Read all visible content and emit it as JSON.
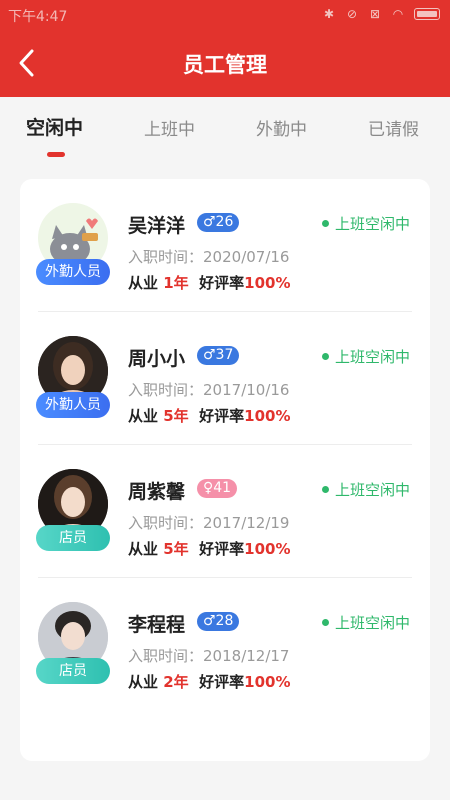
{
  "statusbar": {
    "time": "下午4:47"
  },
  "header": {
    "title": "员工管理"
  },
  "tabs": [
    "空闲中",
    "上班中",
    "外勤中",
    "已请假"
  ],
  "labels": {
    "hire_prefix": "入职时间：",
    "years_prefix": "从业",
    "rating_prefix": "好评率"
  },
  "employees": [
    {
      "name": "吴洋洋",
      "gender": "♂26",
      "gender_type": "male",
      "role": "外勤人员",
      "status": "上班空闲中",
      "hire_date": "2020/07/16",
      "years": "1年",
      "rating": "100%"
    },
    {
      "name": "周小小",
      "gender": "♂37",
      "gender_type": "male",
      "role": "外勤人员",
      "status": "上班空闲中",
      "hire_date": "2017/10/16",
      "years": "5年",
      "rating": "100%"
    },
    {
      "name": "周紫馨",
      "gender": "♀41",
      "gender_type": "female",
      "role": "店员",
      "status": "上班空闲中",
      "hire_date": "2017/12/19",
      "years": "5年",
      "rating": "100%"
    },
    {
      "name": "李程程",
      "gender": "♂28",
      "gender_type": "male",
      "role": "店员",
      "status": "上班空闲中",
      "hire_date": "2018/12/17",
      "years": "2年",
      "rating": "100%"
    }
  ],
  "colors": {
    "brand": "#e2332d",
    "status_green": "#2fb86b",
    "male": "#3a78e0",
    "female": "#f590a9"
  }
}
